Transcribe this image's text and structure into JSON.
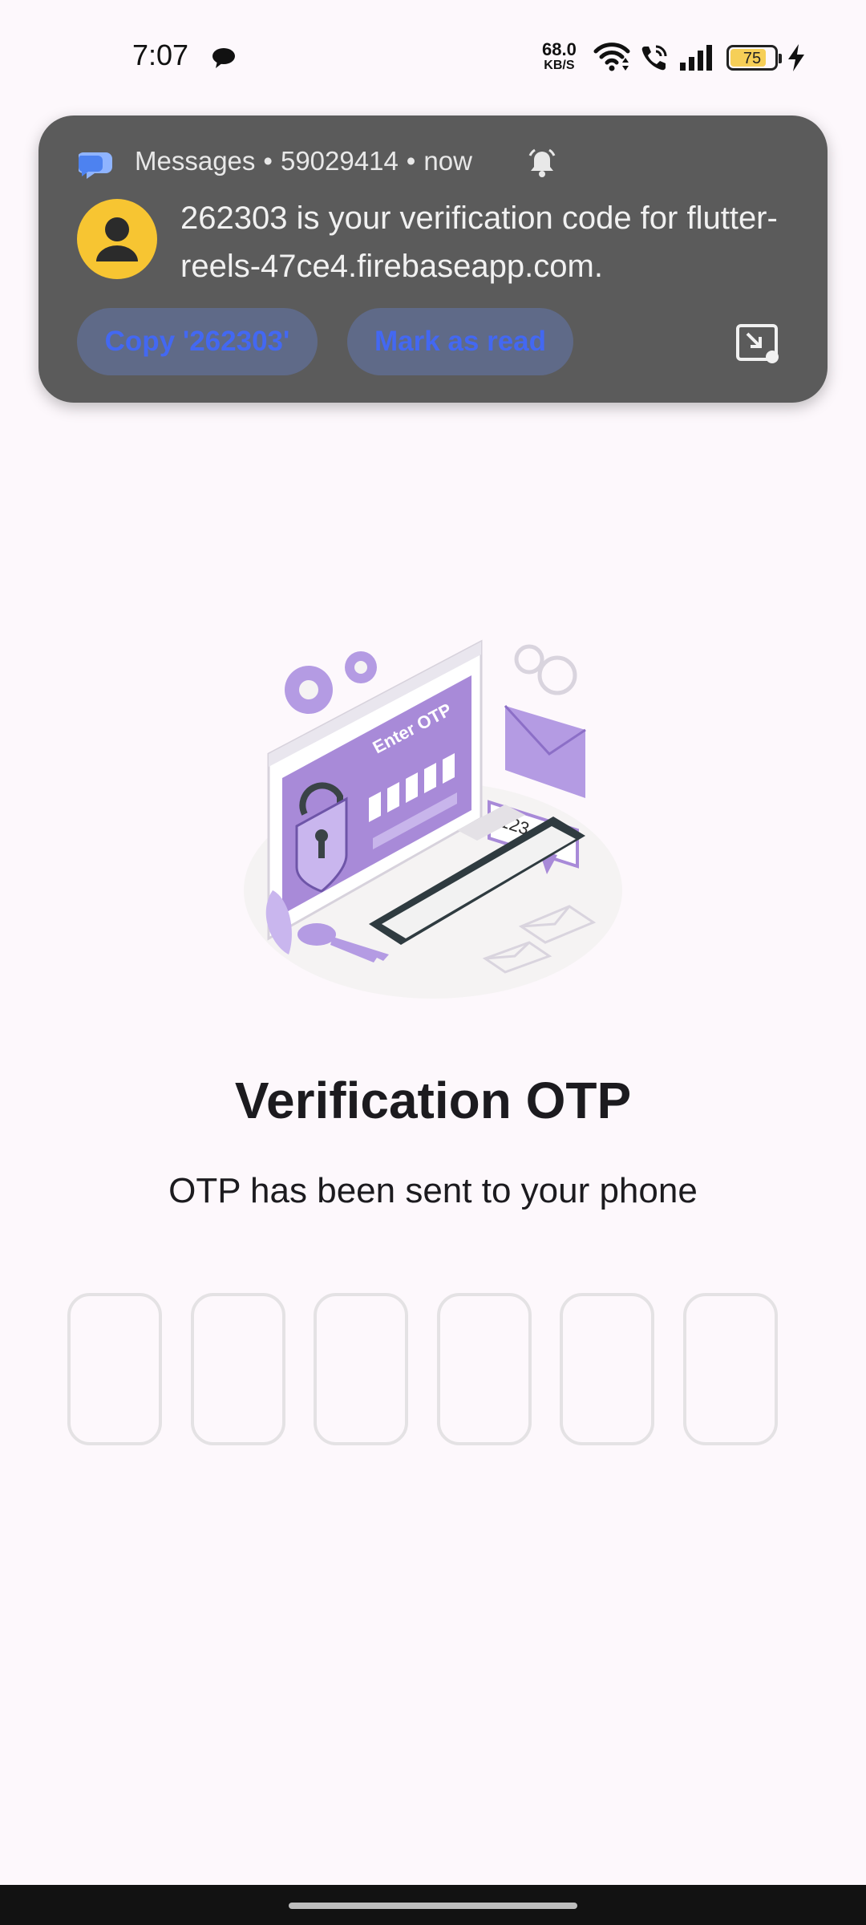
{
  "status_bar": {
    "time": "7:07",
    "net_speed_value": "68.0",
    "net_speed_unit": "KB/S",
    "battery_level": "75"
  },
  "notification": {
    "app_name": "Messages",
    "sender": "59029414",
    "time": "now",
    "sep": "•",
    "body": "262303 is your verification code for flutter-reels-47ce4.firebaseapp.com.",
    "copy_button": "Copy '262303'",
    "mark_read_button": "Mark as read"
  },
  "illustration": {
    "screen_heading": "Enter OTP",
    "code_tag": "123-456"
  },
  "main": {
    "title": "Verification OTP",
    "subtitle": "OTP has been sent to your phone",
    "otp_digits": [
      "",
      "",
      "",
      "",
      "",
      ""
    ]
  },
  "colors": {
    "background": "#fdf8fc",
    "notification_bg": "#5b5b5b",
    "notification_action_text": "#4368f2",
    "illustration_accent": "#a88ad8",
    "avatar_bg": "#f7c532"
  }
}
